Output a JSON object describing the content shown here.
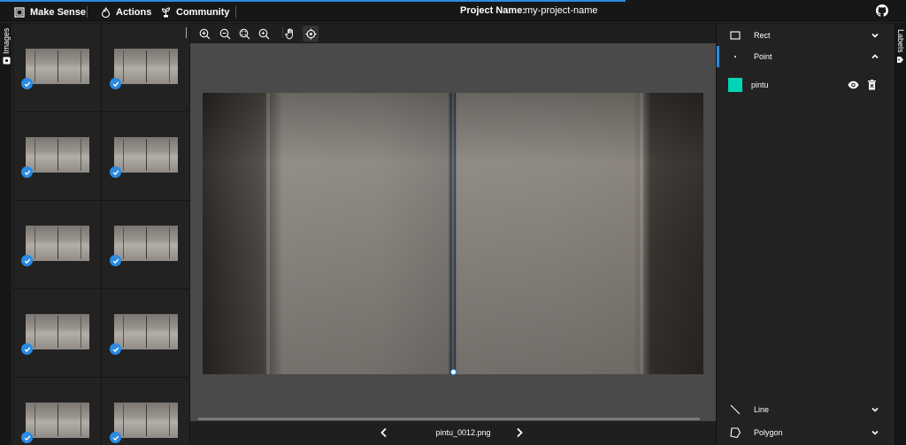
{
  "topbar": {
    "app_name": "Make Sense",
    "actions_label": "Actions",
    "community_label": "Community",
    "project_label": "Project Name:",
    "project_name": "my-project-name",
    "progress_percent": 69
  },
  "left_tab": {
    "label": "Images"
  },
  "right_tab": {
    "label": "Labels"
  },
  "images": {
    "count_visible": 10,
    "all_checked": true
  },
  "toolbar": {
    "tools": [
      "zoom-in-icon",
      "zoom-out-icon",
      "zoom-fit-icon",
      "zoom-reset-icon",
      "pan-hand-icon",
      "crosshair-icon"
    ],
    "active_tool": "crosshair-icon"
  },
  "editor": {
    "filename": "pintu_0012.png"
  },
  "label_panel": {
    "sections": {
      "rect": "Rect",
      "point": "Point",
      "line": "Line",
      "polygon": "Polygon"
    },
    "active_section": "Point",
    "labels": [
      {
        "name": "pintu",
        "color": "#00d4b4"
      }
    ]
  },
  "colors": {
    "accent": "#2b8ae2",
    "background": "#171717",
    "panel": "#222222",
    "canvas": "#4a4a4a"
  }
}
